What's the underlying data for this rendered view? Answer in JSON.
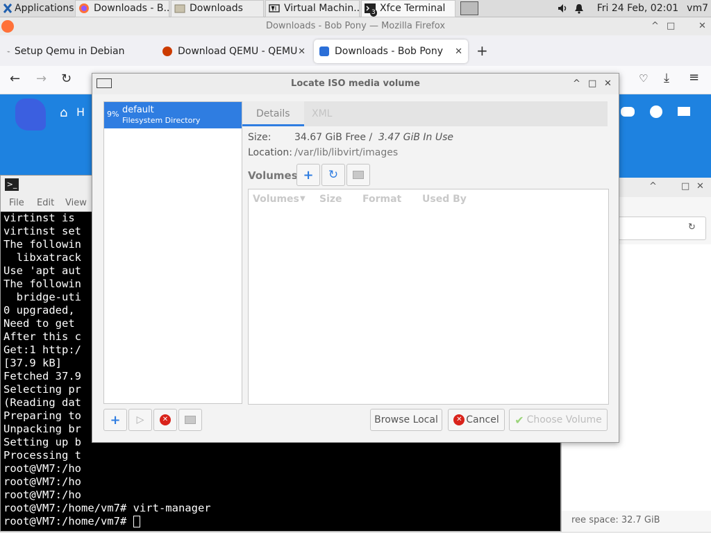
{
  "panel": {
    "applications": "Applications",
    "tasks": [
      {
        "label": "Downloads - B..."
      },
      {
        "label": "Downloads"
      },
      {
        "label": "Virtual Machin..."
      },
      {
        "label": "Xfce Terminal"
      }
    ],
    "clock": "Fri 24 Feb, 02:01",
    "user": "vm7",
    "terminal_badge": "3"
  },
  "firefox": {
    "window_title": "Downloads - Bob Pony — Mozilla Firefox",
    "tabs": [
      {
        "label": "Setup Qemu in Debian Li"
      },
      {
        "label": "Download QEMU - QEMU"
      },
      {
        "label": "Downloads - Bob Pony"
      }
    ],
    "page_nav_fragment": "H"
  },
  "file_manager": {
    "free_space": "ree space: 32.7 GiB"
  },
  "terminal": {
    "menu": [
      "File",
      "Edit",
      "View"
    ],
    "lines": [
      "virtinst is",
      "virtinst set",
      "The followin",
      "  libxatrack",
      "Use 'apt aut",
      "The followin",
      "  bridge-uti",
      "0 upgraded,",
      "Need to get",
      "After this c",
      "Get:1 http:/",
      "[37.9 kB]",
      "Fetched 37.9",
      "Selecting pr",
      "(Reading dat",
      "Preparing to",
      "Unpacking br",
      "Setting up b",
      "Processing t",
      "root@VM7:/ho",
      "root@VM7:/ho",
      "root@VM7:/ho",
      "root@VM7:/home/vm7# virt-manager",
      "root@VM7:/home/vm7# "
    ]
  },
  "dialog": {
    "title": "Locate ISO media volume",
    "pool": {
      "percent": "9%",
      "name": "default",
      "type": "Filesystem Directory"
    },
    "tabs": [
      "Details",
      "XML"
    ],
    "size_label": "Size:",
    "size_free": "34.67 GiB Free / ",
    "size_used": "3.47 GiB In Use",
    "location_label": "Location:",
    "location_value": "/var/lib/libvirt/images",
    "volumes_label": "Volumes",
    "columns": [
      "Volumes",
      "Size",
      "Format",
      "Used By"
    ],
    "browse_local": "Browse Local",
    "cancel": "Cancel",
    "choose_volume": "Choose Volume"
  }
}
